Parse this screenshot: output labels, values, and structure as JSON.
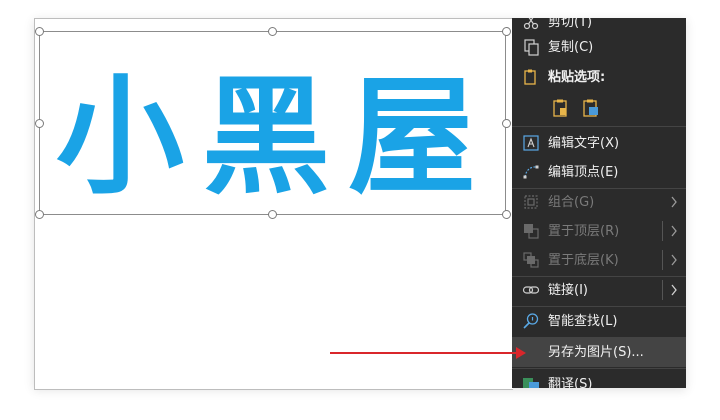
{
  "wordart": {
    "text": "小黑屋",
    "color": "#1aa3e6"
  },
  "menu": {
    "items": {
      "cut": "剪切(T)",
      "copy": "复制(C)",
      "paste_options": "粘贴选项:",
      "edit_text": "编辑文字(X)",
      "edit_points": "编辑顶点(E)",
      "group": "组合(G)",
      "bring_front": "置于顶层(R)",
      "send_back": "置于底层(K)",
      "link": "链接(I)",
      "smart_lookup": "智能查找(L)",
      "save_as_picture": "另存为图片(S)...",
      "translate": "翻译(S)"
    },
    "icons": [
      "scissors-icon",
      "copy-icon",
      "paste-icon",
      "paste-keep-icon",
      "paste-picture-icon",
      "edit-text-icon",
      "edit-points-icon",
      "group-icon",
      "bring-front-icon",
      "send-back-icon",
      "link-icon",
      "search-icon",
      "translate-icon"
    ]
  },
  "colors": {
    "menu_bg": "#2b2b2b",
    "highlight": "#444444",
    "accent_arrow": "#d9262b"
  }
}
